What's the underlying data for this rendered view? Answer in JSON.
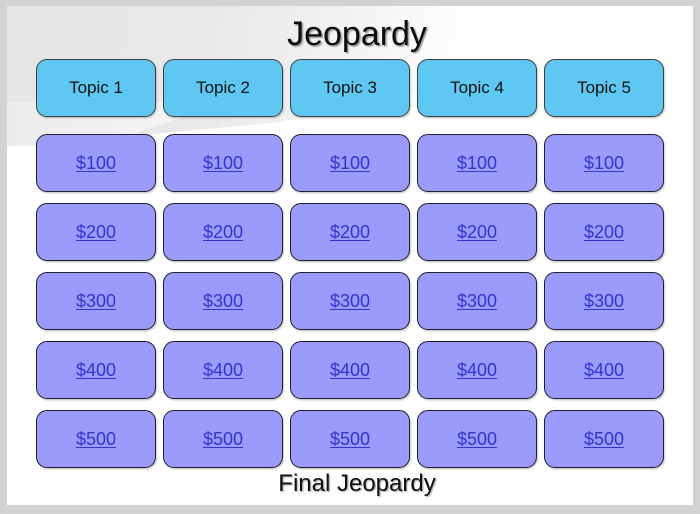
{
  "board": {
    "title": "Jeopardy",
    "footer_label": "Final Jeopardy",
    "colors": {
      "topic_fill": "#5EC8F2",
      "value_fill": "#9B9BFB",
      "value_text": "#3434CF",
      "title_text": "#0D0D0D",
      "frame": "#D2D2D4",
      "canvas": "#FFFFFF",
      "swoosh": "#E6E6E6"
    },
    "columns": [
      {
        "topic": "Topic 1",
        "values": [
          "$100",
          "$200",
          "$300",
          "$400",
          "$500"
        ]
      },
      {
        "topic": "Topic 2",
        "values": [
          "$100",
          "$200",
          "$300",
          "$400",
          "$500"
        ]
      },
      {
        "topic": "Topic 3",
        "values": [
          "$100",
          "$200",
          "$300",
          "$400",
          "$500"
        ]
      },
      {
        "topic": "Topic 4",
        "values": [
          "$100",
          "$200",
          "$300",
          "$400",
          "$500"
        ]
      },
      {
        "topic": "Topic 5",
        "values": [
          "$100",
          "$200",
          "$300",
          "$400",
          "$500"
        ]
      }
    ],
    "rows": [
      {
        "amount": "$100",
        "cells": [
          "$100",
          "$100",
          "$100",
          "$100",
          "$100"
        ]
      },
      {
        "amount": "$200",
        "cells": [
          "$200",
          "$200",
          "$200",
          "$200",
          "$200"
        ]
      },
      {
        "amount": "$300",
        "cells": [
          "$300",
          "$300",
          "$300",
          "$300",
          "$300"
        ]
      },
      {
        "amount": "$400",
        "cells": [
          "$400",
          "$400",
          "$400",
          "$400",
          "$400"
        ]
      },
      {
        "amount": "$500",
        "cells": [
          "$500",
          "$500",
          "$500",
          "$500",
          "$500"
        ]
      }
    ]
  }
}
